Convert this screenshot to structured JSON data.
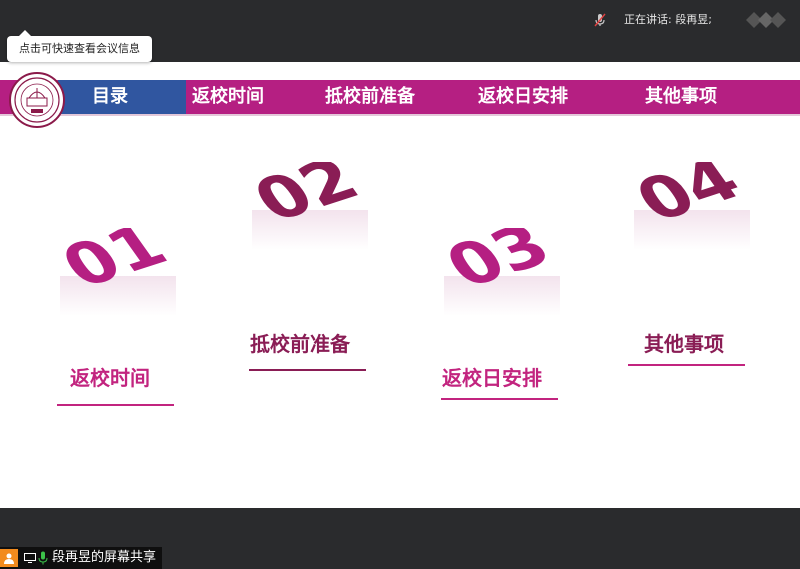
{
  "topbar": {
    "speaker_text": "正在讲话: 段再昱;"
  },
  "tooltip": {
    "text": "点击可快速查看会议信息"
  },
  "slide": {
    "nav": {
      "title": "目录",
      "items": [
        "返校时间",
        "抵校前准备",
        "返校日安排",
        "其他事项"
      ]
    },
    "sections": [
      {
        "number": "01",
        "title": "返校时间"
      },
      {
        "number": "02",
        "title": "抵校前准备"
      },
      {
        "number": "03",
        "title": "返校日安排"
      },
      {
        "number": "04",
        "title": "其他事项"
      }
    ],
    "colors": {
      "magenta": "#b51f82",
      "blue": "#3056a0",
      "pink_text": "#c2247f",
      "dark_text": "#8a1d55"
    }
  },
  "share": {
    "label": "段再昱的屏幕共享",
    "icons": [
      "user-icon",
      "screen-icon",
      "mic-icon"
    ]
  }
}
